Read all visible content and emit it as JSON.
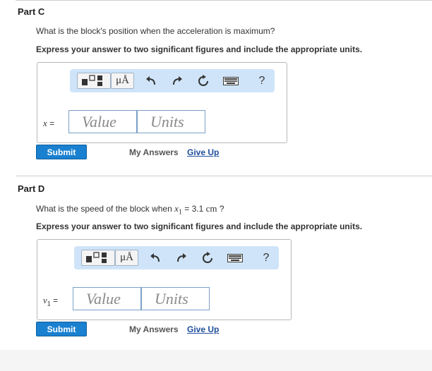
{
  "part_c": {
    "title": "Part C",
    "question": "What is the block's position when the acceleration is maximum?",
    "instruction": "Express your answer to two significant figures and include the appropriate units.",
    "var_symbol": "x",
    "var_eq": "=",
    "value_placeholder": "Value",
    "units_placeholder": "Units",
    "submit_label": "Submit",
    "my_answers_label": "My Answers",
    "give_up_label": "Give Up"
  },
  "part_d": {
    "title": "Part D",
    "question_prefix": "What is the speed of the block when ",
    "question_var": "x",
    "question_sub": "1",
    "question_eq": " = 3.1 ",
    "question_unit": "cm",
    "question_suffix": " ?",
    "instruction": "Express your answer to two significant figures and include the appropriate units.",
    "var_symbol": "v",
    "var_sub": "1",
    "var_eq": "=",
    "value_placeholder": "Value",
    "units_placeholder": "Units",
    "submit_label": "Submit",
    "my_answers_label": "My Answers",
    "give_up_label": "Give Up"
  },
  "toolbar": {
    "units_symbol": "μÅ",
    "help": "?"
  },
  "colors": {
    "toolbar_bg": "#cfe4f8",
    "submit_bg": "#1a80d0",
    "link": "#1f4e9c"
  }
}
